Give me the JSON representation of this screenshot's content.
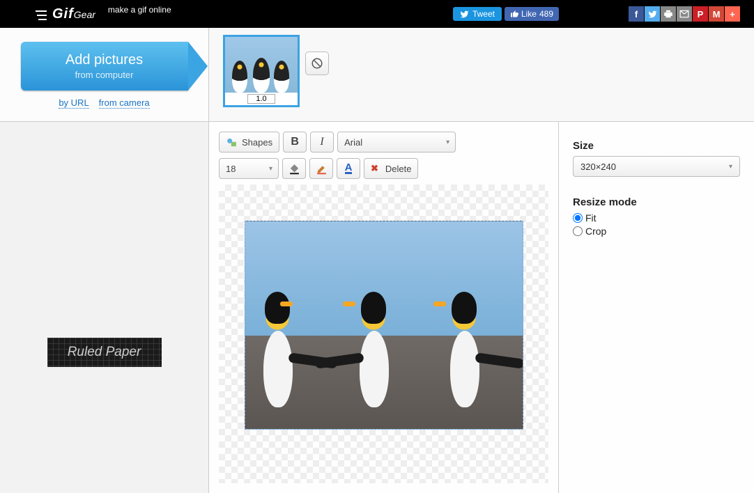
{
  "header": {
    "logo_main": "Gif",
    "logo_sub": "Gear",
    "tagline": "make a gif online",
    "tweet_label": "Tweet",
    "like_label": "Like",
    "like_count": "489"
  },
  "sidebar": {
    "add_line1": "Add pictures",
    "add_line2": "from computer",
    "by_url": "by URL",
    "from_camera": "from camera",
    "promo_text": "Ruled Paper"
  },
  "frames": [
    {
      "duration": "1.0"
    }
  ],
  "toolbar": {
    "shapes": "Shapes",
    "font_family": "Arial",
    "font_size": "18",
    "delete": "Delete"
  },
  "settings": {
    "size_label": "Size",
    "size_value": "320×240",
    "resize_label": "Resize mode",
    "fit": "Fit",
    "crop": "Crop",
    "selected_mode": "fit"
  }
}
